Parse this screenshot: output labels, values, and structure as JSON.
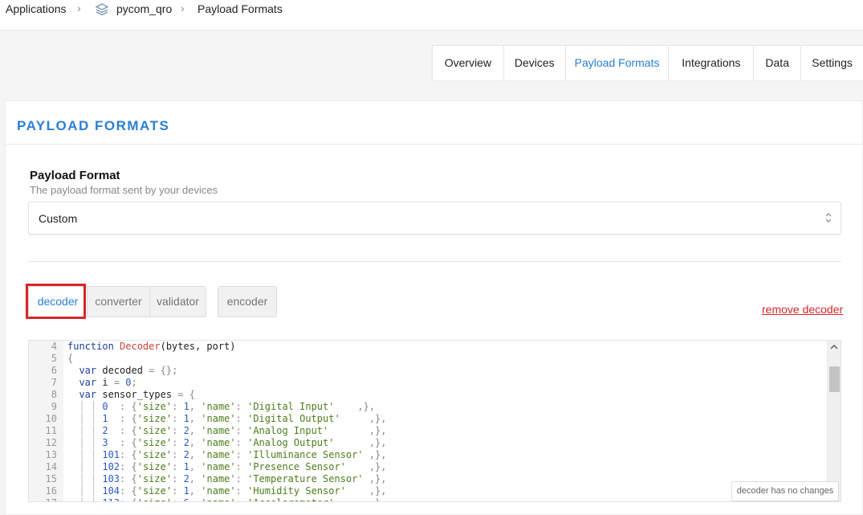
{
  "breadcrumb": {
    "items": [
      "Applications",
      "pycom_qro",
      "Payload Formats"
    ],
    "app_icon": "layers-icon",
    "separator_icon": "chevron-right-icon"
  },
  "tabs": [
    {
      "label": "Overview",
      "active": false
    },
    {
      "label": "Devices",
      "active": false
    },
    {
      "label": "Payload Formats",
      "active": true
    },
    {
      "label": "Integrations",
      "active": false
    },
    {
      "label": "Data",
      "active": false
    },
    {
      "label": "Settings",
      "active": false
    }
  ],
  "panel": {
    "title": "PAYLOAD FORMATS",
    "field_label": "Payload Format",
    "field_description": "The payload format sent by your devices",
    "select_value": "Custom"
  },
  "function_tabs": [
    {
      "label": "decoder",
      "active": true
    },
    {
      "label": "converter",
      "active": false
    },
    {
      "label": "validator",
      "active": false
    }
  ],
  "encoder_label": "encoder",
  "remove_link": "remove decoder",
  "editor": {
    "line_numbers": [
      "4",
      "5",
      "6",
      "7",
      "8",
      "9",
      "10",
      "11",
      "12",
      "13",
      "14",
      "15",
      "16",
      "17"
    ],
    "status": "decoder has no changes"
  },
  "colors": {
    "accent": "#2a7fd4",
    "danger": "#d7262b"
  }
}
